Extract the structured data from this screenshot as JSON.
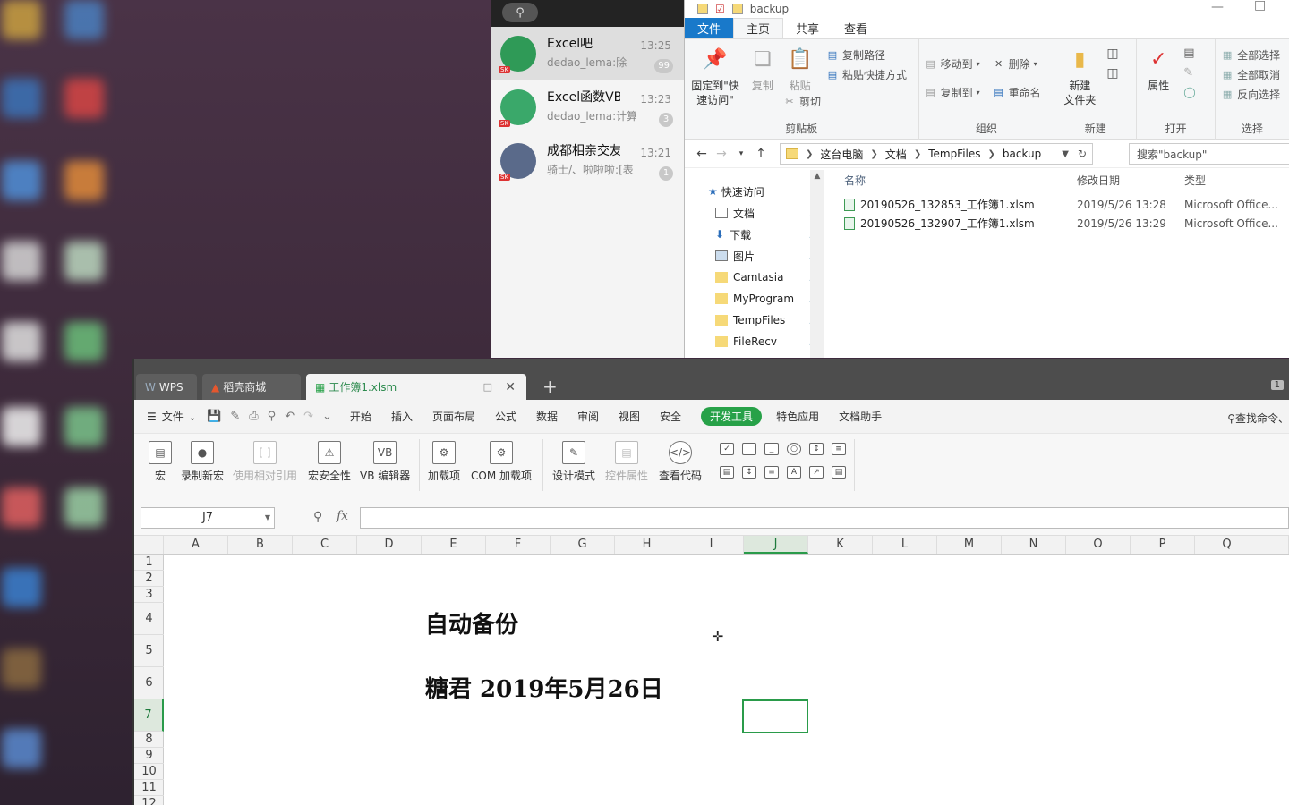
{
  "qq": {
    "chats": [
      {
        "name": "Excel吧",
        "preview": "dedao_lema:除",
        "time": "13:25",
        "badge": "99",
        "avatar_color": "#2f9a57",
        "level": "SK"
      },
      {
        "name": "Excel函数VB",
        "preview": "dedao_lema:计算",
        "time": "13:23",
        "badge": "3",
        "avatar_color": "#3aa86a",
        "level": "SK"
      },
      {
        "name": "成都相亲交友",
        "preview": "骑士/、啦啦啦:[表",
        "time": "13:21",
        "badge": "1",
        "avatar_color": "#5a6a8a",
        "level": "SK"
      }
    ]
  },
  "explorer": {
    "window_title": "backup",
    "tabs": {
      "file": "文件",
      "home": "主页",
      "share": "共享",
      "view": "查看"
    },
    "ribbon": {
      "clipboard": {
        "pin": "固定到\"快\n速访问\"",
        "copy": "复制",
        "paste": "粘贴",
        "copy_path": "复制路径",
        "paste_shortcut": "粘贴快捷方式",
        "cut": "剪切",
        "group": "剪贴板"
      },
      "organize": {
        "move_to": "移动到",
        "copy_to": "复制到",
        "delete": "删除",
        "rename": "重命名",
        "group": "组织"
      },
      "new": {
        "new_folder": "新建\n文件夹",
        "group": "新建"
      },
      "open": {
        "properties": "属性",
        "group": "打开"
      },
      "select": {
        "select_all": "全部选择",
        "select_none": "全部取消",
        "invert": "反向选择",
        "group": "选择"
      }
    },
    "breadcrumb": [
      "这台电脑",
      "文档",
      "TempFiles",
      "backup"
    ],
    "search_placeholder": "搜索\"backup\"",
    "nav": [
      {
        "label": "快速访问",
        "type": "star"
      },
      {
        "label": "文档",
        "type": "doc"
      },
      {
        "label": "下载",
        "type": "download"
      },
      {
        "label": "图片",
        "type": "pic"
      },
      {
        "label": "Camtasia",
        "type": "folder"
      },
      {
        "label": "MyProgram",
        "type": "folder"
      },
      {
        "label": "TempFiles",
        "type": "folder"
      },
      {
        "label": "FileRecv",
        "type": "folder"
      }
    ],
    "columns": {
      "name": "名称",
      "modified": "修改日期",
      "type": "类型"
    },
    "files": [
      {
        "name": "20190526_132853_工作簿1.xlsm",
        "modified": "2019/5/26 13:28",
        "type": "Microsoft Office..."
      },
      {
        "name": "20190526_132907_工作簿1.xlsm",
        "modified": "2019/5/26 13:29",
        "type": "Microsoft Office..."
      }
    ]
  },
  "wps": {
    "tabs": {
      "wps": "WPS",
      "store": "稻壳商城",
      "doc": "工作簿1.xlsm",
      "add": "+",
      "window_count": "1"
    },
    "menu": {
      "file": "文件",
      "items": [
        "开始",
        "插入",
        "页面布局",
        "公式",
        "数据",
        "审阅",
        "视图",
        "安全"
      ],
      "active": "开发工具",
      "items_after": [
        "特色应用",
        "文档助手"
      ],
      "search": "查找命令、"
    },
    "toolbar": {
      "macro": "宏",
      "record": "录制新宏",
      "relative": "使用相对引用",
      "security": "宏安全性",
      "vb_editor": "VB 编辑器",
      "addins": "加载项",
      "com_addins": "COM 加载项",
      "design_mode": "设计模式",
      "control_props": "控件属性",
      "view_code": "查看代码"
    },
    "name_box": "J7",
    "fx": "fx",
    "columns": [
      "A",
      "B",
      "C",
      "D",
      "E",
      "F",
      "G",
      "H",
      "I",
      "J",
      "K",
      "L",
      "M",
      "N",
      "O",
      "P",
      "Q",
      "R"
    ],
    "rows": [
      "1",
      "2",
      "3",
      "4",
      "5",
      "6",
      "7",
      "8",
      "9",
      "10",
      "11",
      "12"
    ],
    "selected_col": "J",
    "selected_row": "7",
    "cells": {
      "title": "自动备份",
      "author_line": "糖君  2019年5月26日"
    },
    "accent": "#27a148"
  }
}
